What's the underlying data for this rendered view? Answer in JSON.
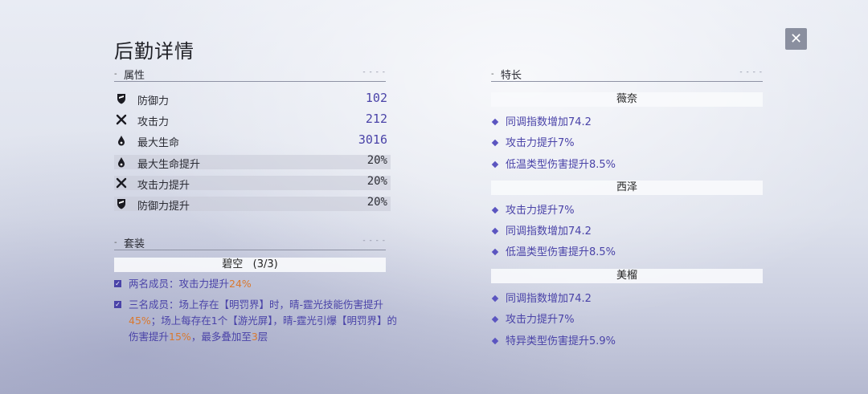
{
  "header": {
    "title": "后勤详情",
    "close_label": "✕"
  },
  "attributes": {
    "heading": "属性",
    "rows": [
      {
        "icon": "shield-icon",
        "label": "防御力",
        "value": "102"
      },
      {
        "icon": "crossed-swords-icon",
        "label": "攻击力",
        "value": "212"
      },
      {
        "icon": "droplet-icon",
        "label": "最大生命",
        "value": "3016"
      },
      {
        "icon": "droplet-icon",
        "label": "最大生命提升",
        "value": "20%"
      },
      {
        "icon": "crossed-swords-icon",
        "label": "攻击力提升",
        "value": "20%"
      },
      {
        "icon": "shield-icon",
        "label": "防御力提升",
        "value": "20%"
      }
    ]
  },
  "set": {
    "heading": "套装",
    "name": "碧空",
    "count": "(3/3)",
    "bonus2": {
      "prefix": "两名成员：攻击力提升",
      "hl": "24%"
    },
    "bonus3": {
      "p1": "三名成员：场上存在【明罚界】时，晴-霆光技能伤害提升",
      "h1": "45%",
      "p2": "；场上每存在1个【游光屏】，晴-霆光引爆【明罚界】的伤害提升",
      "h2": "15%",
      "p3": "，最多叠加至",
      "h3": "3",
      "p4": "层"
    }
  },
  "specialties": {
    "heading": "特长",
    "groups": [
      {
        "name": "薇奈",
        "perks": [
          "同调指数增加74.2",
          "攻击力提升7%",
          "低温类型伤害提升8.5%"
        ]
      },
      {
        "name": "西泽",
        "perks": [
          "攻击力提升7%",
          "同调指数增加74.2",
          "低温类型伤害提升8.5%"
        ]
      },
      {
        "name": "美榴",
        "perks": [
          "同调指数增加74.2",
          "攻击力提升7%",
          "特异类型伤害提升5.9%"
        ]
      }
    ]
  },
  "colors": {
    "accent": "#4a43a8",
    "highlight": "#d9782f"
  }
}
